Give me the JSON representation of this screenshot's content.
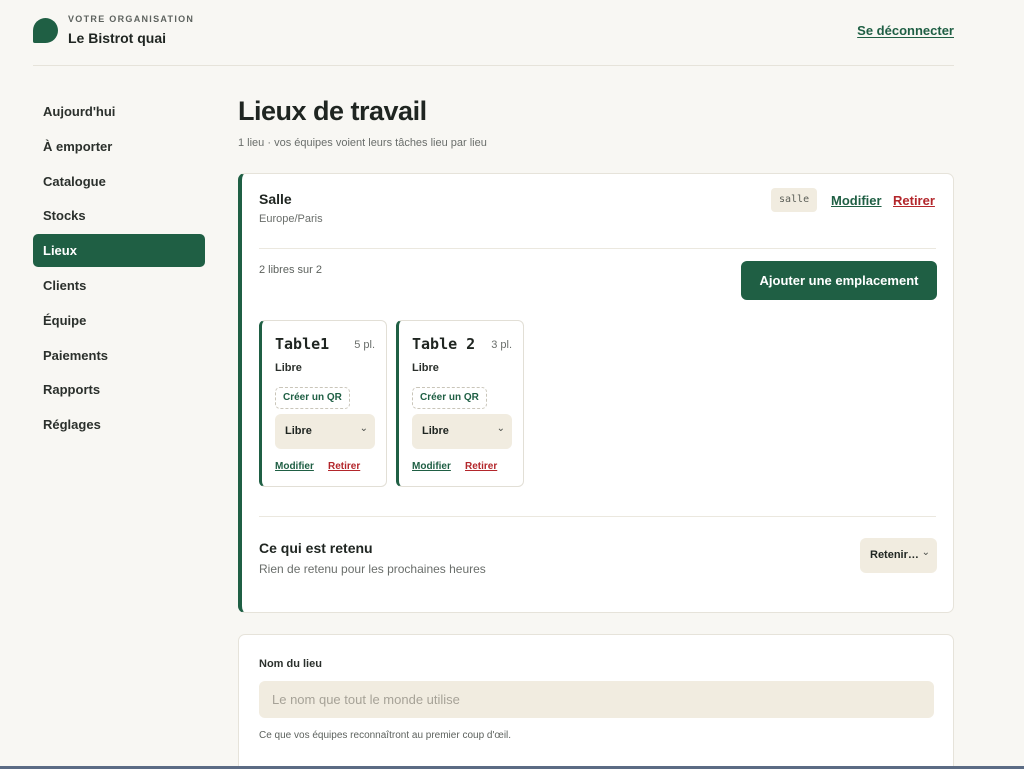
{
  "header": {
    "org_kicker": "VOTRE ORGANISATION",
    "org_name": "Le Bistrot quai",
    "logout_label": "Se déconnecter"
  },
  "sidebar": {
    "items": [
      {
        "label": "Aujourd'hui",
        "active": false
      },
      {
        "label": "À emporter",
        "active": false
      },
      {
        "label": "Catalogue",
        "active": false
      },
      {
        "label": "Stocks",
        "active": false
      },
      {
        "label": "Lieux",
        "active": true
      },
      {
        "label": "Clients",
        "active": false
      },
      {
        "label": "Équipe",
        "active": false
      },
      {
        "label": "Paiements",
        "active": false
      },
      {
        "label": "Rapports",
        "active": false
      },
      {
        "label": "Réglages",
        "active": false
      }
    ]
  },
  "main": {
    "title": "Lieux de travail",
    "subtitle": "1 lieu · vos équipes voient leurs tâches lieu par lieu"
  },
  "lieu": {
    "name": "Salle",
    "timezone": "Europe/Paris",
    "slug": "salle",
    "modify_label": "Modifier",
    "remove_label": "Retirer",
    "free_count": "2 libres sur 2",
    "add_button_label": "Ajouter une emplacement",
    "tables": [
      {
        "name": "Table1",
        "seats": "5 pl.",
        "status": "Libre",
        "qr_label": "Créer un QR",
        "select_value": "Libre",
        "modify_label": "Modifier",
        "remove_label": "Retirer"
      },
      {
        "name": "Table 2",
        "seats": "3 pl.",
        "status": "Libre",
        "qr_label": "Créer un QR",
        "select_value": "Libre",
        "modify_label": "Modifier",
        "remove_label": "Retirer"
      }
    ],
    "held": {
      "title": "Ce qui est retenu",
      "subtitle": "Rien de retenu pour les prochaines heures",
      "select_value": "Retenir…"
    }
  },
  "form": {
    "label": "Nom du lieu",
    "placeholder": "Le nom que tout le monde utilise",
    "value": "",
    "help": "Ce que vos équipes reconnaîtront au premier coup d'œil."
  },
  "icons": {
    "chevron": "chevron-down-icon",
    "logo": "logo-leaf-icon"
  },
  "colors": {
    "brand": "#1f5f44",
    "danger": "#b3262b",
    "background": "#f8f7f3",
    "field": "#f1ece0"
  }
}
